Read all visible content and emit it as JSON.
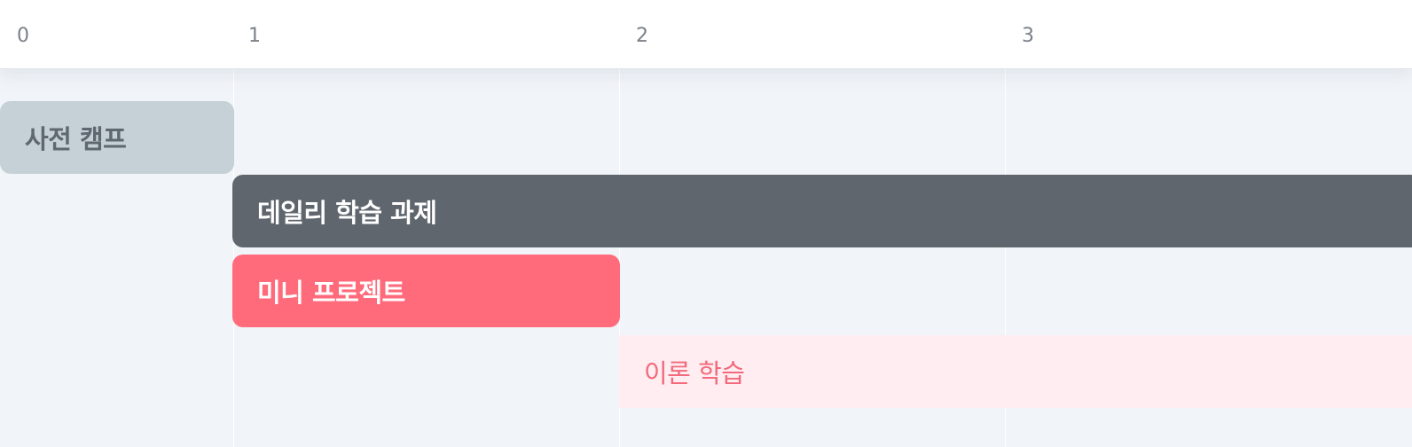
{
  "header": {
    "ticks": [
      "0",
      "1",
      "2",
      "3"
    ]
  },
  "schedule": {
    "items": [
      {
        "label": "사전 캠프",
        "start": 0,
        "end": 1,
        "style": "muted-gray"
      },
      {
        "label": "데일리 학습 과제",
        "start": 1,
        "end": "beyond 3",
        "style": "dark-gray"
      },
      {
        "label": "미니 프로젝트",
        "start": 1,
        "end": 2,
        "style": "coral"
      },
      {
        "label": "이론 학습",
        "start": 2,
        "end": "beyond 3",
        "style": "light-pink"
      }
    ]
  },
  "colors": {
    "background": "#f1f4f8",
    "header_bg": "#ffffff",
    "tick_text": "#7b8189",
    "precamp_bg": "#c5d0d7",
    "daily_bg": "#5f666e",
    "mini_bg": "#ff6b7b",
    "theory_bg": "#ffedf1",
    "theory_text": "#f26a7b"
  }
}
